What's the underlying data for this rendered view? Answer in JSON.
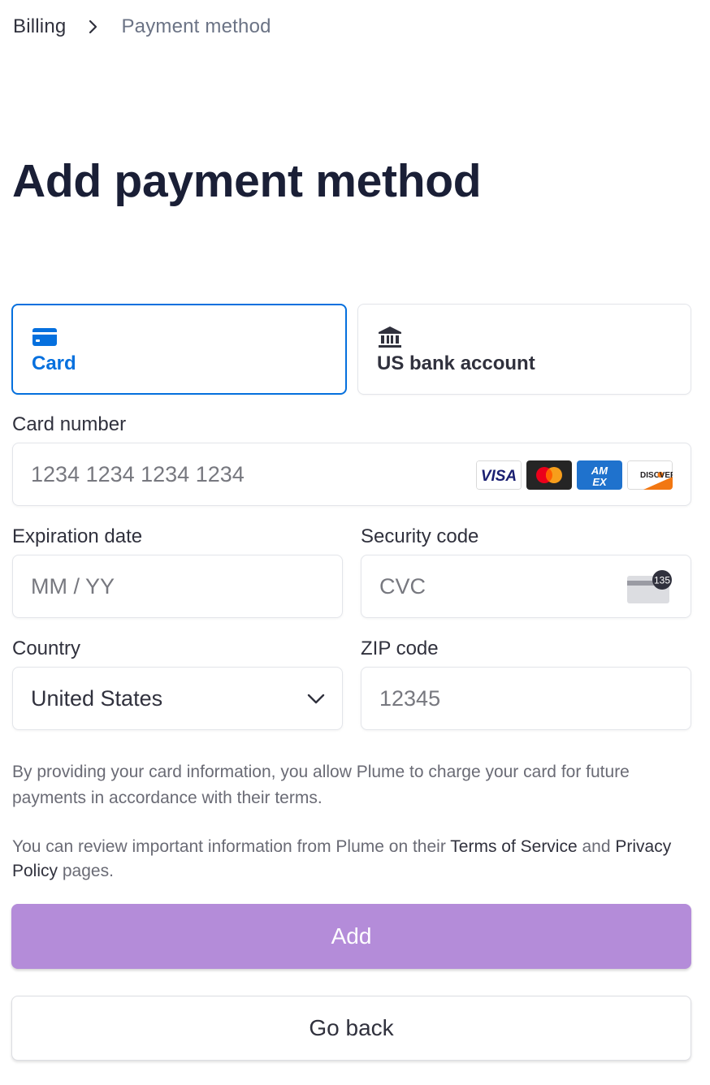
{
  "breadcrumb": {
    "root": "Billing",
    "current": "Payment method",
    "separator_icon": "chevron-right-icon"
  },
  "page": {
    "title": "Add payment method"
  },
  "methods": [
    {
      "label": "Card",
      "icon": "card-icon",
      "selected": true
    },
    {
      "label": "US bank account",
      "icon": "bank-icon",
      "selected": false
    }
  ],
  "form": {
    "card_number": {
      "label": "Card number",
      "placeholder": "1234 1234 1234 1234",
      "value": ""
    },
    "card_brands": [
      {
        "name": "VISA",
        "icon": "visa-icon"
      },
      {
        "name": "Mastercard",
        "icon": "mastercard-icon"
      },
      {
        "name": "AMEX",
        "icon": "amex-icon"
      },
      {
        "name": "DISCOVER",
        "icon": "discover-icon"
      }
    ],
    "expiration": {
      "label": "Expiration date",
      "placeholder": "MM / YY",
      "value": ""
    },
    "security_code": {
      "label": "Security code",
      "placeholder": "CVC",
      "value": "",
      "icon": "cvc-card-icon",
      "icon_text": "135"
    },
    "country": {
      "label": "Country",
      "value": "United States",
      "icon": "chevron-down-icon"
    },
    "zip": {
      "label": "ZIP code",
      "placeholder": "12345",
      "value": ""
    }
  },
  "legal": {
    "consent": "By providing your card information, you allow Plume to charge your card for future payments in accordance with their terms.",
    "review_prefix": "You can review important information from Plume on their",
    "terms_link": "Terms of Service",
    "and_text": "and",
    "privacy_link": "Privacy Policy",
    "review_suffix": "pages."
  },
  "actions": {
    "add_label": "Add",
    "back_label": "Go back"
  },
  "colors": {
    "accent": "#0570de",
    "primary_button": "#b48cd9",
    "heading": "#1a1f36",
    "text": "#30313d",
    "muted": "#6b7385",
    "border": "#e3e5ea"
  }
}
